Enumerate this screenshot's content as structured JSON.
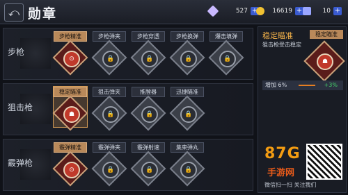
{
  "header": {
    "back_icon": "back-arrow-icon",
    "title": "勋章",
    "resources": [
      {
        "icon": "diamond-icon",
        "value": "527",
        "color": "#c9b9ff"
      },
      {
        "icon": "gold-coin-icon",
        "value": "16619",
        "color": "#f1c232"
      },
      {
        "icon": "ticket-icon",
        "value": "10",
        "color": "#9aa6ff"
      }
    ]
  },
  "rows": [
    {
      "category": "步枪",
      "slots": [
        {
          "label": "步枪精准",
          "active": true,
          "selected": false
        },
        {
          "label": "步枪弹夹",
          "active": false,
          "selected": false
        },
        {
          "label": "步枪穿透",
          "active": false,
          "selected": false
        },
        {
          "label": "步枪换弹",
          "active": false,
          "selected": false
        },
        {
          "label": "爆击填弹",
          "active": false,
          "selected": false
        }
      ]
    },
    {
      "category": "狙击枪",
      "slots": [
        {
          "label": "稳定瞄准",
          "active": true,
          "selected": true
        },
        {
          "label": "狙击弹夹",
          "active": false,
          "selected": false
        },
        {
          "label": "推膛器",
          "active": false,
          "selected": false
        },
        {
          "label": "迅捷瞄准",
          "active": false,
          "selected": false
        }
      ]
    },
    {
      "category": "霰弹枪",
      "slots": [
        {
          "label": "霰弹精准",
          "active": true,
          "selected": false
        },
        {
          "label": "霰弹弹夹",
          "active": false,
          "selected": false
        },
        {
          "label": "霰弹射速",
          "active": false,
          "selected": false
        },
        {
          "label": "集束弹丸",
          "active": false,
          "selected": false
        }
      ]
    }
  ],
  "detail": {
    "name": "稳定瞄准",
    "description": "狙击枪受击稳定",
    "tag": "稳定瞄准",
    "bonus_label": "增加 6%",
    "bonus_value": "+3%"
  },
  "watermark": {
    "logo": "87G",
    "site": "手游网",
    "caption": "微信扫一扫 关注我们"
  }
}
